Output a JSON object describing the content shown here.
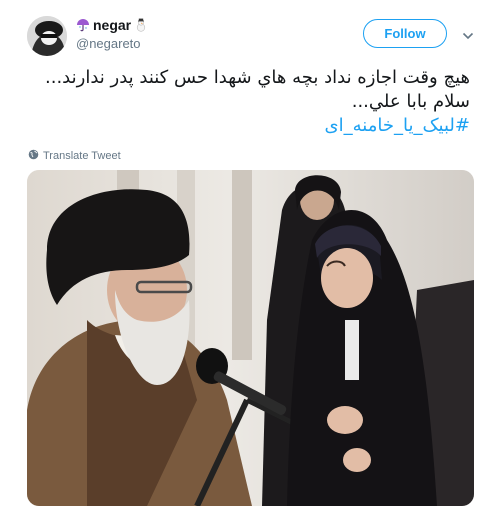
{
  "user": {
    "display_name": "negar",
    "handle": "@negareto",
    "emoji_left": "umbrella-icon",
    "emoji_right": "snowman-icon"
  },
  "follow_button": {
    "label": "Follow"
  },
  "menu": {
    "icon": "chevron-down-icon"
  },
  "tweet": {
    "line1": "هیچ وقت اجازه نداد بچه هاي شهدا حس کنند پدر ندارند...",
    "line2": "سلام بابا علي...",
    "hashtag": "#لبیک_یا_خامنه_ای"
  },
  "translate": {
    "label": "Translate Tweet",
    "icon": "globe-icon"
  },
  "colors": {
    "accent": "#1da1f2",
    "text": "#14171a",
    "secondary": "#657786"
  }
}
